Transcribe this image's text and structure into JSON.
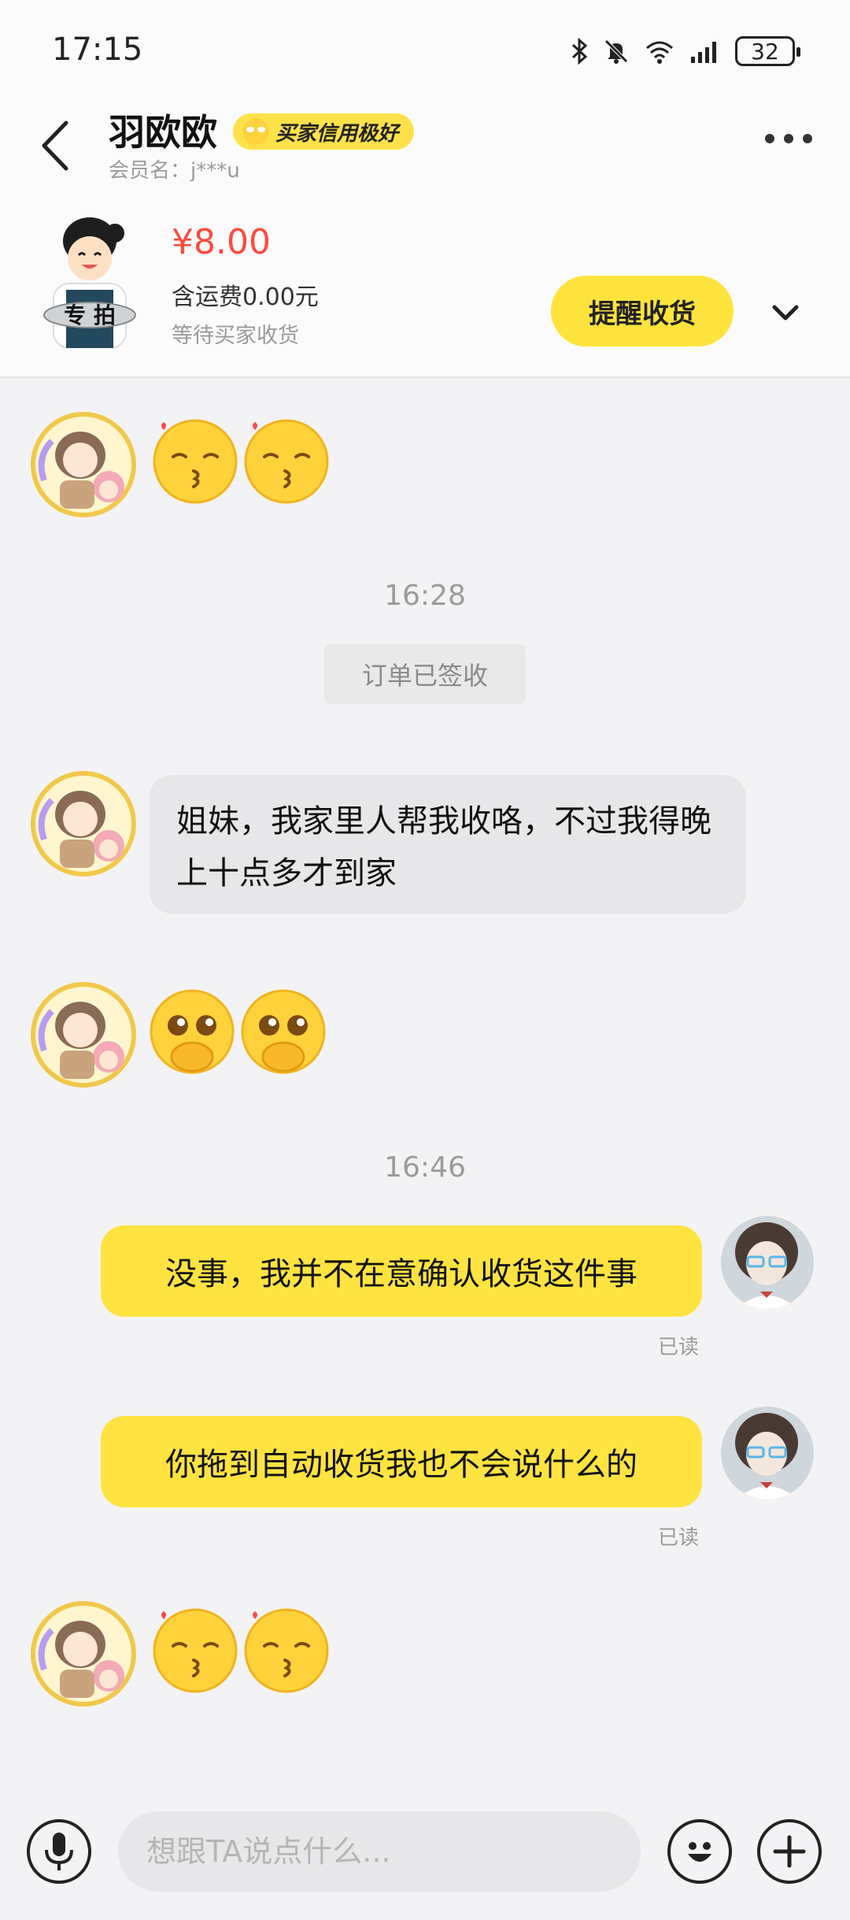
{
  "status_bar": {
    "time": "17:15",
    "battery": "32"
  },
  "header": {
    "name": "羽欧欧",
    "badge": "买家信用极好",
    "member": "会员名：j***u"
  },
  "order": {
    "thumb_label": "专 拍",
    "price": "¥8.00",
    "shipping": "含运费0.00元",
    "status": "等待买家收货",
    "remind_button": "提醒收货"
  },
  "chat": {
    "time1": "16:28",
    "system_note": "订单已签收",
    "incoming_message": "姐妹，我家里人帮我收咯，不过我得晚上十点多才到家",
    "time2": "16:46",
    "outgoing1": "没事，我并不在意确认收货这件事",
    "outgoing2": "你拖到自动收货我也不会说什么的",
    "read_label": "已读"
  },
  "input": {
    "placeholder": "想跟TA说点什么..."
  },
  "colors": {
    "accent": "#ffe340",
    "price": "#ff4a3d"
  }
}
